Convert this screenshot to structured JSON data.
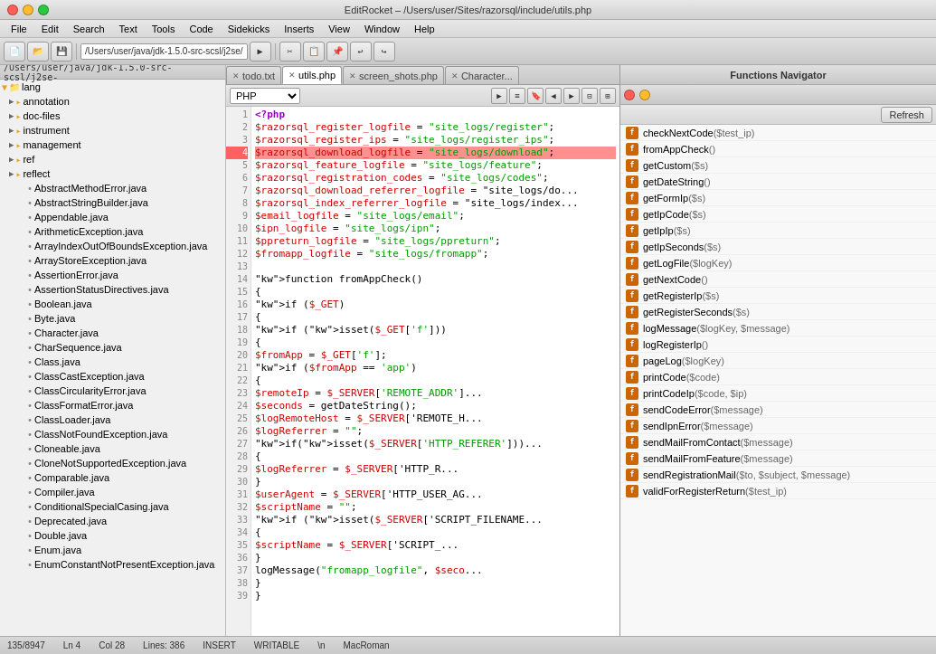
{
  "titleBar": {
    "title": "EditRocket – /Users/user/Sites/razorsql/include/utils.php"
  },
  "menuBar": {
    "items": [
      "File",
      "Edit",
      "Search",
      "Text",
      "Tools",
      "Code",
      "Sidekicks",
      "Inserts",
      "View",
      "Window",
      "Help"
    ]
  },
  "toolbar": {
    "path": "/Users/user/java/jdk-1.5.0-src-scsl/j2se/"
  },
  "tabs": [
    {
      "label": "todo.txt",
      "active": false,
      "closable": true
    },
    {
      "label": "utils.php",
      "active": true,
      "closable": true
    },
    {
      "label": "screen_shots.php",
      "active": false,
      "closable": true
    },
    {
      "label": "Character...",
      "active": false,
      "closable": true
    }
  ],
  "sidebar": {
    "path": "/Users/user/java/jdk-1.5.0-src-scsl/j2se-",
    "root": "lang",
    "items": [
      {
        "label": "annotation",
        "type": "folder",
        "indent": 1
      },
      {
        "label": "doc-files",
        "type": "folder",
        "indent": 1
      },
      {
        "label": "instrument",
        "type": "folder",
        "indent": 1
      },
      {
        "label": "management",
        "type": "folder",
        "indent": 1
      },
      {
        "label": "ref",
        "type": "folder",
        "indent": 1
      },
      {
        "label": "reflect",
        "type": "folder",
        "indent": 1
      },
      {
        "label": "AbstractMethodError.java",
        "type": "file",
        "indent": 2
      },
      {
        "label": "AbstractStringBuilder.java",
        "type": "file",
        "indent": 2
      },
      {
        "label": "Appendable.java",
        "type": "file",
        "indent": 2
      },
      {
        "label": "ArithmeticException.java",
        "type": "file",
        "indent": 2
      },
      {
        "label": "ArrayIndexOutOfBoundsException.java",
        "type": "file",
        "indent": 2
      },
      {
        "label": "ArrayStoreException.java",
        "type": "file",
        "indent": 2
      },
      {
        "label": "AssertionError.java",
        "type": "file",
        "indent": 2
      },
      {
        "label": "AssertionStatusDirectives.java",
        "type": "file",
        "indent": 2
      },
      {
        "label": "Boolean.java",
        "type": "file",
        "indent": 2
      },
      {
        "label": "Byte.java",
        "type": "file",
        "indent": 2
      },
      {
        "label": "Character.java",
        "type": "file",
        "indent": 2
      },
      {
        "label": "CharSequence.java",
        "type": "file",
        "indent": 2
      },
      {
        "label": "Class.java",
        "type": "file",
        "indent": 2
      },
      {
        "label": "ClassCastException.java",
        "type": "file",
        "indent": 2
      },
      {
        "label": "ClassCircularityError.java",
        "type": "file",
        "indent": 2
      },
      {
        "label": "ClassFormatError.java",
        "type": "file",
        "indent": 2
      },
      {
        "label": "ClassLoader.java",
        "type": "file",
        "indent": 2
      },
      {
        "label": "ClassNotFoundException.java",
        "type": "file",
        "indent": 2
      },
      {
        "label": "Cloneable.java",
        "type": "file",
        "indent": 2
      },
      {
        "label": "CloneNotSupportedException.java",
        "type": "file",
        "indent": 2
      },
      {
        "label": "Comparable.java",
        "type": "file",
        "indent": 2
      },
      {
        "label": "Compiler.java",
        "type": "file",
        "indent": 2
      },
      {
        "label": "ConditionalSpecialCasing.java",
        "type": "file",
        "indent": 2
      },
      {
        "label": "Deprecated.java",
        "type": "file",
        "indent": 2
      },
      {
        "label": "Double.java",
        "type": "file",
        "indent": 2
      },
      {
        "label": "Enum.java",
        "type": "file",
        "indent": 2
      },
      {
        "label": "EnumConstantNotPresentException.java",
        "type": "file",
        "indent": 2
      }
    ]
  },
  "editor": {
    "language": "PHP",
    "lines": [
      {
        "num": 1,
        "text": "<?php",
        "highlight": false
      },
      {
        "num": 2,
        "text": "$razorsql_register_logfile = \"site_logs/register\";",
        "highlight": false
      },
      {
        "num": 3,
        "text": "$razorsql_register_ips = \"site_logs/register_ips\";",
        "highlight": false
      },
      {
        "num": 4,
        "text": "$razorsql_download_logfile = \"site_logs/download\";",
        "highlight": true
      },
      {
        "num": 5,
        "text": "$razorsql_feature_logfile = \"site_logs/feature\";",
        "highlight": false
      },
      {
        "num": 6,
        "text": "$razorsql_registration_codes = \"site_logs/codes\";",
        "highlight": false
      },
      {
        "num": 7,
        "text": "$razorsql_download_referrer_logfile = \"site_logs/do...",
        "highlight": false
      },
      {
        "num": 8,
        "text": "$razorsql_index_referrer_logfile = \"site_logs/index...",
        "highlight": false
      },
      {
        "num": 9,
        "text": "$email_logfile = \"site_logs/email\";",
        "highlight": false
      },
      {
        "num": 10,
        "text": "$ipn_logfile = \"site_logs/ipn\";",
        "highlight": false
      },
      {
        "num": 11,
        "text": "$ppreturn_logfile = \"site_logs/ppreturn\";",
        "highlight": false
      },
      {
        "num": 12,
        "text": "$fromapp_logfile = \"site_logs/fromapp\";",
        "highlight": false
      },
      {
        "num": 13,
        "text": "",
        "highlight": false
      },
      {
        "num": 14,
        "text": "function fromAppCheck()",
        "highlight": false
      },
      {
        "num": 15,
        "text": "{",
        "highlight": false
      },
      {
        "num": 16,
        "text": "    if ($_GET)",
        "highlight": false
      },
      {
        "num": 17,
        "text": "    {",
        "highlight": false
      },
      {
        "num": 18,
        "text": "        if (isset($_GET['f']))",
        "highlight": false
      },
      {
        "num": 19,
        "text": "        {",
        "highlight": false
      },
      {
        "num": 20,
        "text": "            $fromApp = $_GET['f'];",
        "highlight": false
      },
      {
        "num": 21,
        "text": "            if ($fromApp == 'app')",
        "highlight": false
      },
      {
        "num": 22,
        "text": "            {",
        "highlight": false
      },
      {
        "num": 23,
        "text": "                $remoteIp = $_SERVER['REMOTE_ADDR']...",
        "highlight": false
      },
      {
        "num": 24,
        "text": "                $seconds = getDateString();",
        "highlight": false
      },
      {
        "num": 25,
        "text": "                $logRemoteHost = $_SERVER['REMOTE_H...",
        "highlight": false
      },
      {
        "num": 26,
        "text": "                $logReferrer = \"\";",
        "highlight": false
      },
      {
        "num": 27,
        "text": "                if(isset($_SERVER['HTTP_REFERER']))...",
        "highlight": false
      },
      {
        "num": 28,
        "text": "                {",
        "highlight": false
      },
      {
        "num": 29,
        "text": "                    $logReferrer = $_SERVER['HTTP_R...",
        "highlight": false
      },
      {
        "num": 30,
        "text": "                }",
        "highlight": false
      },
      {
        "num": 31,
        "text": "                $userAgent = $_SERVER['HTTP_USER_AG...",
        "highlight": false
      },
      {
        "num": 32,
        "text": "                $scriptName = \"\";",
        "highlight": false
      },
      {
        "num": 33,
        "text": "                if (isset($_SERVER['SCRIPT_FILENAME...",
        "highlight": false
      },
      {
        "num": 34,
        "text": "                {",
        "highlight": false
      },
      {
        "num": 35,
        "text": "                    $scriptName = $_SERVER['SCRIPT_...",
        "highlight": false
      },
      {
        "num": 36,
        "text": "                }",
        "highlight": false
      },
      {
        "num": 37,
        "text": "                logMessage(\"fromapp_logfile\", $seco...",
        "highlight": false
      },
      {
        "num": 38,
        "text": "            }",
        "highlight": false
      },
      {
        "num": 39,
        "text": "        }",
        "highlight": false
      }
    ]
  },
  "functionsNav": {
    "title": "Functions Navigator",
    "refreshLabel": "Refresh",
    "functions": [
      {
        "name": "checkNextCode",
        "params": "($test_ip)"
      },
      {
        "name": "fromAppCheck",
        "params": "()"
      },
      {
        "name": "getCustom",
        "params": "($s)"
      },
      {
        "name": "getDateString",
        "params": "()"
      },
      {
        "name": "getFormIp",
        "params": "($s)"
      },
      {
        "name": "getIpCode",
        "params": "($s)"
      },
      {
        "name": "getIpIp",
        "params": "($s)"
      },
      {
        "name": "getIpSeconds",
        "params": "($s)"
      },
      {
        "name": "getLogFile",
        "params": "($logKey)"
      },
      {
        "name": "getNextCode",
        "params": "()"
      },
      {
        "name": "getRegisterIp",
        "params": "($s)"
      },
      {
        "name": "getRegisterSeconds",
        "params": "($s)"
      },
      {
        "name": "logMessage",
        "params": "($logKey, $message)"
      },
      {
        "name": "logRegisterIp",
        "params": "()"
      },
      {
        "name": "pageLog",
        "params": "($logKey)"
      },
      {
        "name": "printCode",
        "params": "($code)"
      },
      {
        "name": "printCodeIp",
        "params": "($code, $ip)"
      },
      {
        "name": "sendCodeError",
        "params": "($message)"
      },
      {
        "name": "sendIpnError",
        "params": "($message)"
      },
      {
        "name": "sendMailFromContact",
        "params": "($message)"
      },
      {
        "name": "sendMailFromFeature",
        "params": "($message)"
      },
      {
        "name": "sendRegistrationMail",
        "params": "($to, $subject, $message)"
      },
      {
        "name": "validForRegisterReturn",
        "params": "($test_ip)"
      }
    ]
  },
  "statusBar": {
    "position": "135/8947",
    "line": "Ln 4",
    "col": "Col 28",
    "lines": "Lines: 386",
    "mode": "INSERT",
    "writable": "WRITABLE",
    "lineEnding": "\\n",
    "encoding": "MacRoman"
  }
}
